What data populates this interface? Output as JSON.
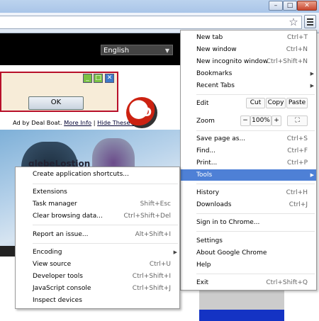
{
  "page": {
    "language": "English",
    "ok_label": "OK",
    "ad_prefix": "Ad by Deal Boat.",
    "ad_more_info": "More Info",
    "ad_sep": "|",
    "ad_hide": "Hide These Ads",
    "hd_logo": "HD",
    "photo_text": "glebeLostion"
  },
  "menu": {
    "new_tab": {
      "label": "New tab",
      "shortcut": "Ctrl+T"
    },
    "new_window": {
      "label": "New window",
      "shortcut": "Ctrl+N"
    },
    "new_incognito": {
      "label": "New incognito window",
      "shortcut": "Ctrl+Shift+N"
    },
    "bookmarks": {
      "label": "Bookmarks"
    },
    "recent_tabs": {
      "label": "Recent Tabs"
    },
    "edit": {
      "label": "Edit",
      "cut": "Cut",
      "copy": "Copy",
      "paste": "Paste"
    },
    "zoom": {
      "label": "Zoom",
      "minus": "−",
      "value": "100%",
      "plus": "+",
      "fullscreen": "⛶"
    },
    "save_page": {
      "label": "Save page as...",
      "shortcut": "Ctrl+S"
    },
    "find": {
      "label": "Find...",
      "shortcut": "Ctrl+F"
    },
    "print": {
      "label": "Print...",
      "shortcut": "Ctrl+P"
    },
    "tools": {
      "label": "Tools"
    },
    "history": {
      "label": "History",
      "shortcut": "Ctrl+H"
    },
    "downloads": {
      "label": "Downloads",
      "shortcut": "Ctrl+J"
    },
    "sign_in": {
      "label": "Sign in to Chrome..."
    },
    "settings": {
      "label": "Settings"
    },
    "about": {
      "label": "About Google Chrome"
    },
    "help": {
      "label": "Help"
    },
    "exit": {
      "label": "Exit",
      "shortcut": "Ctrl+Shift+Q"
    }
  },
  "tools_menu": {
    "create_shortcuts": {
      "label": "Create application shortcuts..."
    },
    "extensions": {
      "label": "Extensions"
    },
    "task_manager": {
      "label": "Task manager",
      "shortcut": "Shift+Esc"
    },
    "clear_data": {
      "label": "Clear browsing data...",
      "shortcut": "Ctrl+Shift+Del"
    },
    "report_issue": {
      "label": "Report an issue...",
      "shortcut": "Alt+Shift+I"
    },
    "encoding": {
      "label": "Encoding"
    },
    "view_source": {
      "label": "View source",
      "shortcut": "Ctrl+U"
    },
    "dev_tools": {
      "label": "Developer tools",
      "shortcut": "Ctrl+Shift+I"
    },
    "js_console": {
      "label": "JavaScript console",
      "shortcut": "Ctrl+Shift+J"
    },
    "inspect_devices": {
      "label": "Inspect devices"
    }
  },
  "icons": {
    "submenu_arrow": "▶",
    "star": "☆",
    "dropdown_arrow": "▼"
  },
  "colors": {
    "highlight": "#4e80d6",
    "popup_border": "#b8102a"
  }
}
